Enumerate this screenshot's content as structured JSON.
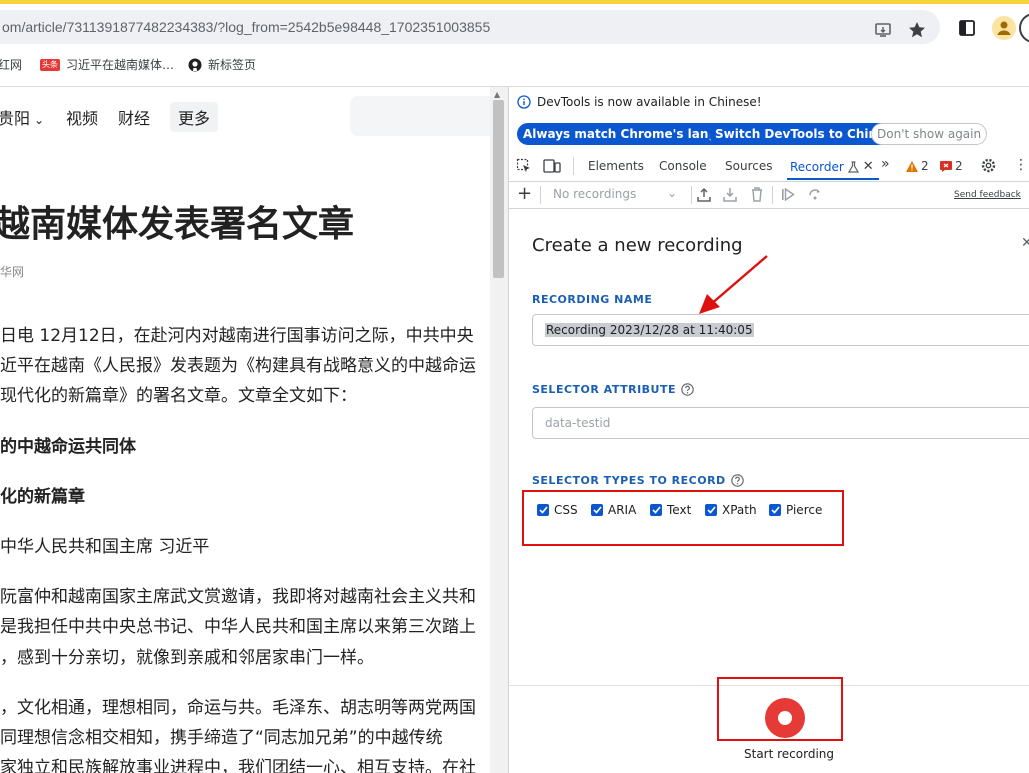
{
  "browser": {
    "url": "om/article/7311391877482234383/?log_from=2542b5e98448_1702351003855",
    "bookmarks": [
      {
        "label": "红网",
        "icon": "none"
      },
      {
        "label": "习近平在越南媒体…",
        "badge": "头条",
        "icon": "badge"
      },
      {
        "label": "新标签页",
        "icon": "github-icon"
      }
    ],
    "icons": [
      "install-app-icon",
      "star-icon",
      "side-panel-icon",
      "profile-icon"
    ]
  },
  "article": {
    "nav": {
      "city": "贵阳",
      "video": "视频",
      "finance": "财经",
      "more": "更多"
    },
    "headline": "越南媒体发表署名文章",
    "source": "华网",
    "paragraphs": [
      "日电 12月12日，在赴河内对越南进行国事访问之际，中共中央",
      "近平在越南《人民报》发表题为《构建具有战略意义的中越命运",
      "现代化的新篇章》的署名文章。文章全文如下：",
      "的中越命运共同体",
      "化的新篇章",
      "中华人民共和国主席 习近平",
      "阮富仲和越南国家主席武文赏邀请，我即将对越南社会主义共和",
      "是我担任中共中央总书记、中华人民共和国主席以来第三次踏上",
      "，感到十分亲切，就像到亲戚和邻居家串门一样。",
      "，文化相通，理想相同，命运与共。毛泽东、胡志明等两党两国",
      "同理想信念相交相知，携手缔造了“同志加兄弟”的中越传统",
      "家独立和民族解放事业进程中，我们团结一心、相互支持。在社"
    ]
  },
  "devtools": {
    "infobar": {
      "text": "DevTools is now available in Chinese!",
      "btn_match": "Always match Chrome's language",
      "btn_switch": "Switch DevTools to Chinese",
      "btn_dismiss": "Don't show again"
    },
    "tabs": {
      "elements": "Elements",
      "console": "Console",
      "sources": "Sources",
      "recorder": "Recorder",
      "warnings": "2",
      "errors": "2"
    },
    "toolbar": {
      "recordings_placeholder": "No recordings",
      "send_feedback": "Send feedback"
    },
    "recording": {
      "title": "Create a new recording",
      "name_label": "RECORDING NAME",
      "name_value": "Recording 2023/12/28 at 11:40:05",
      "selector_attr_label": "SELECTOR ATTRIBUTE",
      "selector_attr_placeholder": "data-testid",
      "selector_types_label": "SELECTOR TYPES TO RECORD",
      "selector_types": [
        {
          "label": "CSS",
          "checked": true
        },
        {
          "label": "ARIA",
          "checked": true
        },
        {
          "label": "Text",
          "checked": true
        },
        {
          "label": "XPath",
          "checked": true
        },
        {
          "label": "Pierce",
          "checked": true
        }
      ],
      "start_label": "Start recording"
    },
    "accent_color": "#0b57d0",
    "annotation_color": "#e01010"
  }
}
